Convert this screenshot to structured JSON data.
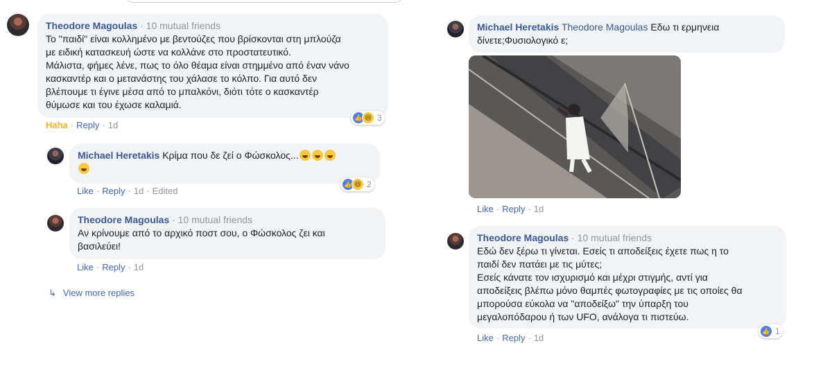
{
  "left": {
    "c1": {
      "name": "Theodore Magoulas",
      "meta": "· 10 mutual friends",
      "lines": [
        "Το \"παιδί\" είναι κολλημένο με βεντούζες που βρίσκονται στη μπλούζα",
        "με ειδική κατασκευή ώστε να κολλάνε στο προστατευτικό.",
        "Μάλιστα, φήμες λένε, πως το όλο θέαμα είναι στημμένο από έναν νάνο",
        "κασκαντέρ και ο μετανάστης του χάλασε το κόλπο. Για αυτό δεν",
        "βλέπουμε τι έγινε μέσα από το μπαλκόνι, διότι τότε ο κασκαντέρ",
        "θύμωσε και του έχωσε καλαμιά."
      ],
      "reaction": "Haha",
      "reply": "Reply",
      "time": "1d",
      "react_count": "3"
    },
    "c2": {
      "name": "Michael Heretakis",
      "text": "Κρίμα που δε ζεί ο Φώσκολος...",
      "like": "Like",
      "reply": "Reply",
      "time": "1d",
      "edited": "Edited",
      "react_count": "2"
    },
    "c3": {
      "name": "Theodore Magoulas",
      "meta": "· 10 mutual friends",
      "lines": [
        "Αν κρίνουμε από το αρχικό ποστ σου, ο Φώσκολος ζει και",
        "βασιλεύει!"
      ],
      "like": "Like",
      "reply": "Reply",
      "time": "1d"
    },
    "view_more": "View more replies"
  },
  "right": {
    "c1": {
      "name": "Michael Heretakis",
      "tag": "Theodore Magoulas",
      "text1": " Εδω τι ερμηνεια",
      "text2": "δίνετε;Φυσιολογικό ε;",
      "like": "Like",
      "reply": "Reply",
      "time": "1d"
    },
    "c2": {
      "name": "Theodore Magoulas",
      "meta": "· 10 mutual friends",
      "lines": [
        "Εδώ δεν ξέρω τι γίνεται. Εσείς τι αποδείξεις έχετε πως η το",
        "παιδί δεν πατάει με τις μύτες;",
        "Εσείς κάνατε τον ισχυρισμό και μέχρι στιγμής, αντί για",
        "αποδείξεις βλέπω μόνο θαμπές φωτογραφίες με τις οποίες θα",
        "μπορούσα εύκολα να \"αποδείξω\" την ύπαρξη του",
        "μεγαλοπόδαρου ή των UFO, ανάλογα τι πιστεύω."
      ],
      "like": "Like",
      "reply": "Reply",
      "time": "1d",
      "react_count": "1"
    }
  },
  "colors": {
    "link": "#385898",
    "action": "#4267b2",
    "bubble": "#f2f3f5",
    "haha": "#f7b125"
  }
}
